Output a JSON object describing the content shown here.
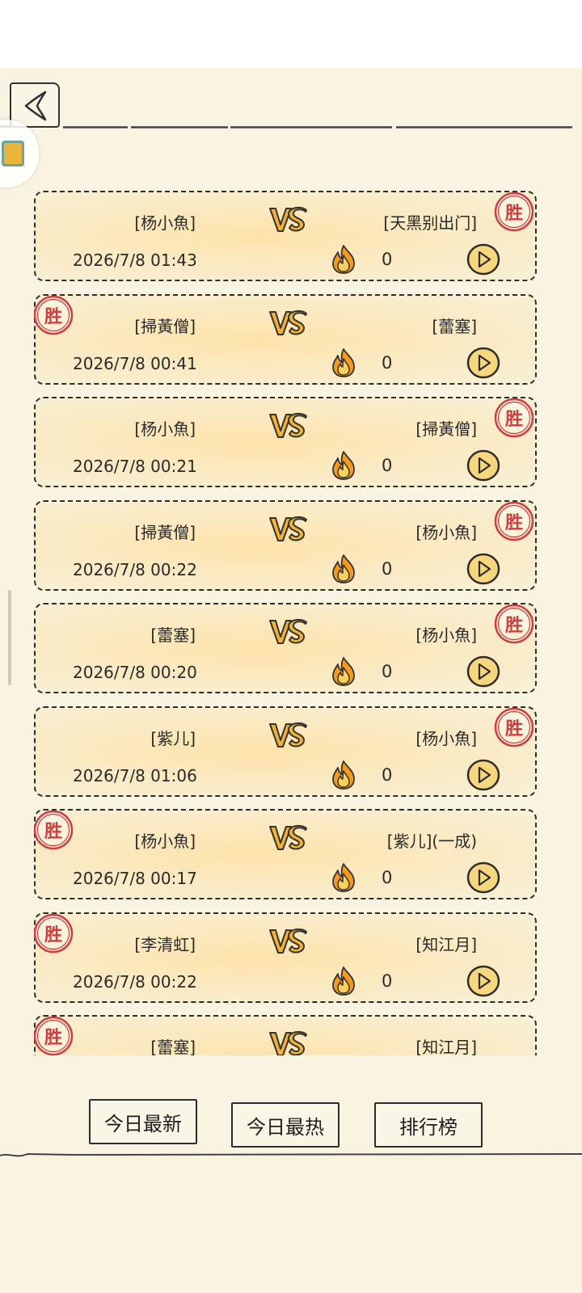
{
  "colors": {
    "background": "#f8f4e1",
    "card_fill": "#fde3aa",
    "seal_red": "#d23c3c",
    "vs_gold": "#f2b233",
    "fire_orange": "#f59b1c"
  },
  "header": {
    "back_icon": "chevron-left-icon"
  },
  "matches": [
    {
      "left": "[杨小魚]",
      "right": "[天黑别出门]",
      "time": "2026/7/8 01:43",
      "heat": "0",
      "winner": "right",
      "seal": "胜"
    },
    {
      "left": "[掃黃僧]",
      "right": "[蕾塞]",
      "time": "2026/7/8 00:41",
      "heat": "0",
      "winner": "left",
      "seal": "胜"
    },
    {
      "left": "[杨小魚]",
      "right": "[掃黃僧]",
      "time": "2026/7/8 00:21",
      "heat": "0",
      "winner": "right",
      "seal": "胜"
    },
    {
      "left": "[掃黃僧]",
      "right": "[杨小魚]",
      "time": "2026/7/8 00:22",
      "heat": "0",
      "winner": "right",
      "seal": "胜"
    },
    {
      "left": "[蕾塞]",
      "right": "[杨小魚]",
      "time": "2026/7/8 00:20",
      "heat": "0",
      "winner": "right",
      "seal": "胜"
    },
    {
      "left": "[紫儿]",
      "right": "[杨小魚]",
      "time": "2026/7/8 01:06",
      "heat": "0",
      "winner": "right",
      "seal": "胜"
    },
    {
      "left": "[杨小魚]",
      "right": "[紫儿](一成)",
      "time": "2026/7/8 00:17",
      "heat": "0",
      "winner": "left",
      "seal": "胜"
    },
    {
      "left": "[李清虹]",
      "right": "[知江月]",
      "time": "2026/7/8 00:22",
      "heat": "0",
      "winner": "left",
      "seal": "胜"
    },
    {
      "left": "[蕾塞]",
      "right": "[知江月]",
      "time": "",
      "heat": "",
      "winner": "left",
      "seal": "胜"
    }
  ],
  "tabs": {
    "latest_label": "今日最新",
    "hot_label": "今日最热",
    "rank_label": "排行榜"
  }
}
